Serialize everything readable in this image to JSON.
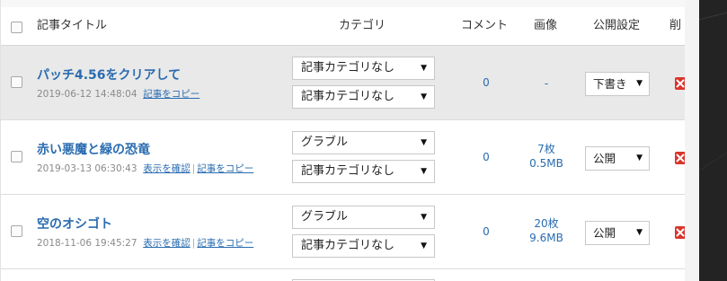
{
  "header": {
    "title_col": "記事タイトル",
    "category_col": "カテゴリ",
    "comment_col": "コメント",
    "image_col": "画像",
    "publish_col": "公開設定",
    "delete_col": "削"
  },
  "rows": [
    {
      "title": "パッチ4.56をクリアして",
      "datetime": "2019-06-12 14:48:04",
      "view_link": "",
      "copy_link": "記事をコピー",
      "category1": "記事カテゴリなし",
      "category2": "記事カテゴリなし",
      "comments": "0",
      "images_count": "-",
      "images_size": "",
      "publish": "下書き"
    },
    {
      "title": "赤い悪魔と緑の恐竜",
      "datetime": "2019-03-13 06:30:43",
      "view_link": "表示を確認",
      "copy_link": "記事をコピー",
      "category1": "グラブル",
      "category2": "記事カテゴリなし",
      "comments": "0",
      "images_count": "7枚",
      "images_size": "0.5MB",
      "publish": "公開"
    },
    {
      "title": "空のオシゴト",
      "datetime": "2018-11-06 19:45:27",
      "view_link": "表示を確認",
      "copy_link": "記事をコピー",
      "category1": "グラブル",
      "category2": "記事カテゴリなし",
      "comments": "0",
      "images_count": "20枚",
      "images_size": "9.6MB",
      "publish": "公開"
    }
  ],
  "colors": {
    "link": "#2a6cb0",
    "row_alt": "#e9e9e9",
    "delete": "#d9342b"
  }
}
